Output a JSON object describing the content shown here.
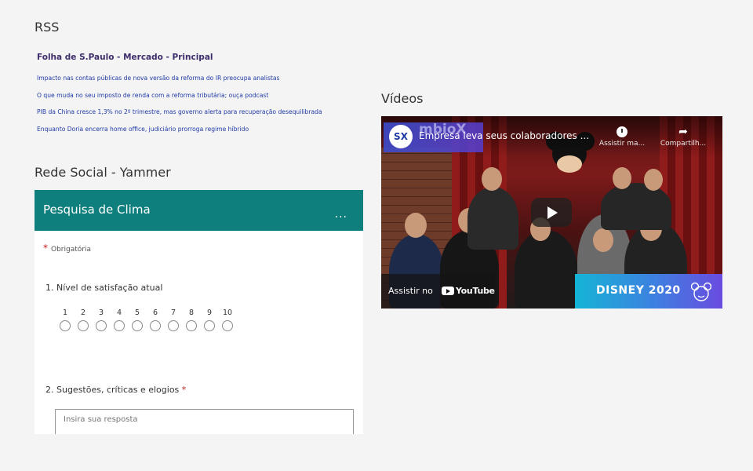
{
  "rss": {
    "section_title": "RSS",
    "feed_name": "Folha de S.Paulo - Mercado - Principal",
    "items": [
      "Impacto nas contas públicas de nova versão da reforma do IR preocupa analistas",
      "O que muda no seu imposto de renda com a reforma tributária; ouça podcast",
      "PIB da China cresce 1,3% no 2º trimestre, mas governo alerta para recuperação desequilibrada",
      "Enquanto Doria encerra home office, judiciário prorroga regime híbrido"
    ]
  },
  "yammer": {
    "section_title": "Rede Social - Yammer",
    "poll_title": "Pesquisa de Clima",
    "more_label": "...",
    "required_star": "*",
    "required_note": "Obrigatória",
    "q1_label": "1. Nível de satisfação atual",
    "scale": [
      "1",
      "2",
      "3",
      "4",
      "5",
      "6",
      "7",
      "8",
      "9",
      "10"
    ],
    "q2_label": "2. Sugestões, críticas e elogios",
    "q2_required": "*",
    "answer_placeholder": "Insira sua resposta"
  },
  "videos": {
    "section_title": "Vídeos",
    "channel_logo": "SX",
    "brand_text": "mbioX",
    "video_title": "Empresa leva seus colaboradores ...",
    "watch_later_label": "Assistir ma...",
    "share_label": "Compartilh...",
    "watch_on_label": "Assistir no",
    "youtube_label": "YouTube",
    "banner_text": "DISNEY 2020",
    "icons": {
      "watch_later": "clock-icon",
      "share": "share-icon",
      "play": "play-icon"
    }
  },
  "colors": {
    "poll_header": "#0f7f7e",
    "rss_link": "#1f3aa6",
    "feed_name": "#3d2e6b",
    "required": "#c0201a"
  }
}
